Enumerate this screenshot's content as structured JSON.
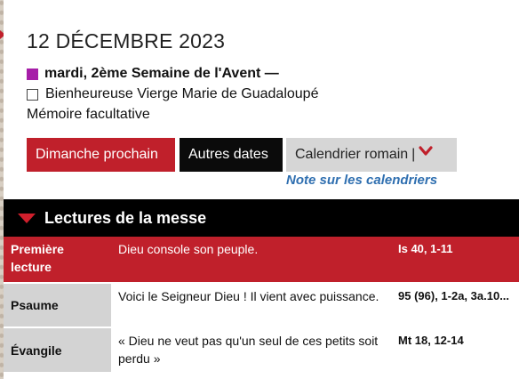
{
  "date_title": "12 DÉCEMBRE 2023",
  "season": {
    "label": "mardi, 2ème Semaine de l'Avent —",
    "color": "#a61ea8"
  },
  "feast": {
    "label": "Bienheureuse Vierge Marie de Guadaloupé",
    "rank": "Mémoire facultative"
  },
  "buttons": {
    "next_sunday": "Dimanche prochain",
    "other_dates": "Autres dates",
    "roman_calendar": "Calendrier romain",
    "separator": "|"
  },
  "icons": {
    "dropdown": "chevron-down-icon",
    "section": "triangle-down-icon"
  },
  "note_link": "Note sur les calendriers",
  "section": {
    "title": "Lectures de la messe"
  },
  "readings": [
    {
      "label": "Première lecture",
      "text": "Dieu console son peuple.",
      "ref": "Is 40, 1-11"
    },
    {
      "label": "Psaume",
      "text": "Voici le Seigneur Dieu ! Il vient avec puissance.",
      "ref": "95 (96), 1-2a, 3a.10..."
    },
    {
      "label": "Évangile",
      "text": "« Dieu ne veut pas qu'un seul de ces petits soit perdu »",
      "ref": "Mt 18, 12-14"
    }
  ],
  "colors": {
    "accent_red": "#c0202b",
    "link_blue": "#2f6fb0",
    "section_black": "#000000"
  }
}
